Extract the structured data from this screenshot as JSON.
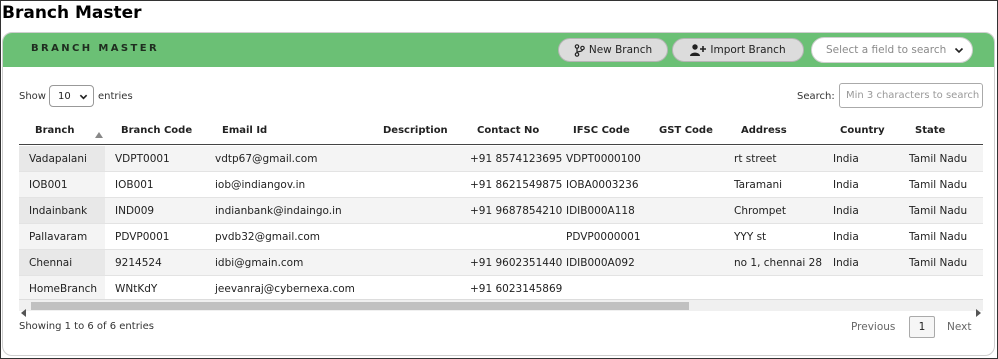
{
  "page": {
    "title": "Branch Master"
  },
  "header": {
    "title": "BRANCH MASTER",
    "new_branch_label": "New Branch",
    "import_branch_label": "Import Branch",
    "field_select_placeholder": "Select a field to search",
    "accent_color": "#6bc075"
  },
  "controls": {
    "show_label": "Show",
    "entries_value": "10",
    "entries_label": "entries",
    "search_label": "Search:",
    "search_placeholder": "Min 3 characters to search"
  },
  "table": {
    "columns": [
      "Branch",
      "Branch Code",
      "Email Id",
      "Description",
      "Contact No",
      "IFSC Code",
      "GST Code",
      "Address",
      "Country",
      "State"
    ],
    "rows": [
      [
        "Vadapalani",
        "VDPT0001",
        "vdtp67@gmail.com",
        "",
        "+91 8574123695",
        "VDPT0000100",
        "",
        "rt street",
        "India",
        "Tamil Nadu"
      ],
      [
        "IOB001",
        "IOB001",
        "iob@indiangov.in",
        "",
        "+91 8621549875",
        "IOBA0003236",
        "",
        "Taramani",
        "India",
        "Tamil Nadu"
      ],
      [
        "Indainbank",
        "IND009",
        "indianbank@indaingo.in",
        "",
        "+91 9687854210",
        "IDIB000A118",
        "",
        "Chrompet",
        "India",
        "Tamil Nadu"
      ],
      [
        "Pallavaram",
        "PDVP0001",
        "pvdb32@gmail.com",
        "",
        "",
        "PDVP0000001",
        "",
        "YYY st",
        "India",
        "Tamil Nadu"
      ],
      [
        "Chennai",
        "9214524",
        "idbi@gmain.com",
        "",
        "+91 9602351440",
        "IDIB000A092",
        "",
        "no 1, chennai 28",
        "India",
        "Tamil Nadu"
      ],
      [
        "HomeBranch",
        "WNtKdY",
        "jeevanraj@cybernexa.com",
        "",
        "+91 6023145869",
        "",
        "",
        "",
        "",
        ""
      ]
    ]
  },
  "footer": {
    "info": "Showing 1 to 6 of 6 entries",
    "previous_label": "Previous",
    "current_page": "1",
    "next_label": "Next"
  }
}
